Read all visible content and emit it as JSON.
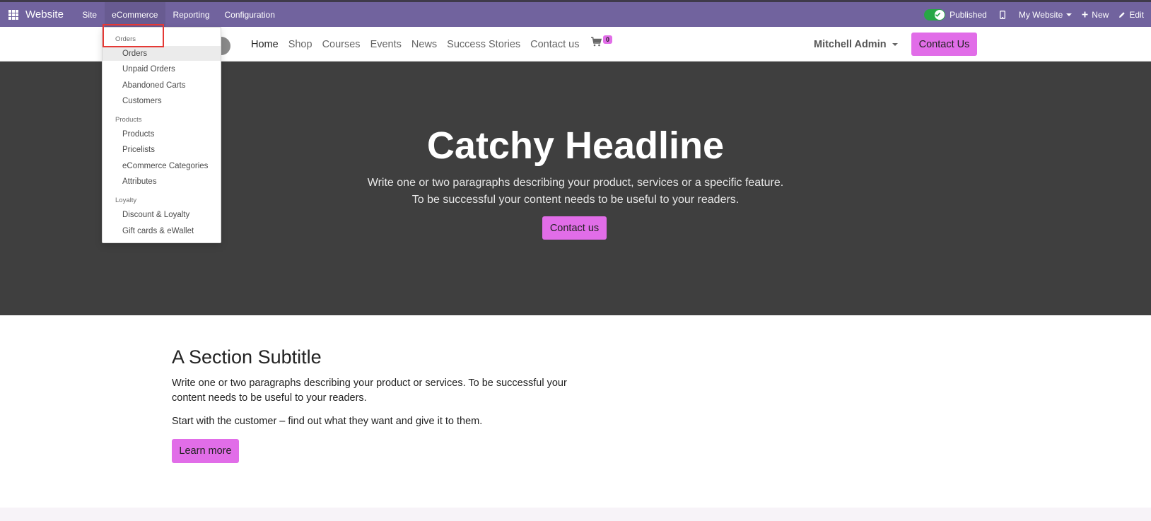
{
  "topbar": {
    "brand": "Website",
    "menu": [
      "Site",
      "eCommerce",
      "Reporting",
      "Configuration"
    ],
    "active_menu": "eCommerce",
    "published_label": "Published",
    "website_label": "My Website",
    "new_label": "New",
    "edit_label": "Edit"
  },
  "sitenav": {
    "links": [
      "Home",
      "Shop",
      "Courses",
      "Events",
      "News",
      "Success Stories",
      "Contact us"
    ],
    "cart_count": "0",
    "user_name": "Mitchell Admin",
    "contact_button": "Contact Us"
  },
  "hero": {
    "headline": "Catchy Headline",
    "line1": "Write one or two paragraphs describing your product, services or a specific feature.",
    "line2": "To be successful your content needs to be useful to your readers.",
    "button": "Contact us"
  },
  "section": {
    "subtitle": "A Section Subtitle",
    "paragraph1": "Write one or two paragraphs describing your product or services. To be successful your content needs to be useful to your readers.",
    "paragraph2": "Start with the customer – find out what they want and give it to them.",
    "button": "Learn more"
  },
  "dropdown": {
    "groups": [
      {
        "header": "Orders",
        "items": [
          "Orders",
          "Unpaid Orders",
          "Abandoned Carts",
          "Customers"
        ]
      },
      {
        "header": "Products",
        "items": [
          "Products",
          "Pricelists",
          "eCommerce Categories",
          "Attributes"
        ]
      },
      {
        "header": "Loyalty",
        "items": [
          "Discount & Loyalty",
          "Gift cards & eWallet"
        ]
      }
    ]
  },
  "colors": {
    "topbar": "#71639e",
    "accent": "#e16de8",
    "hero_bg": "#3f3f3f",
    "highlight": "#e53935"
  }
}
